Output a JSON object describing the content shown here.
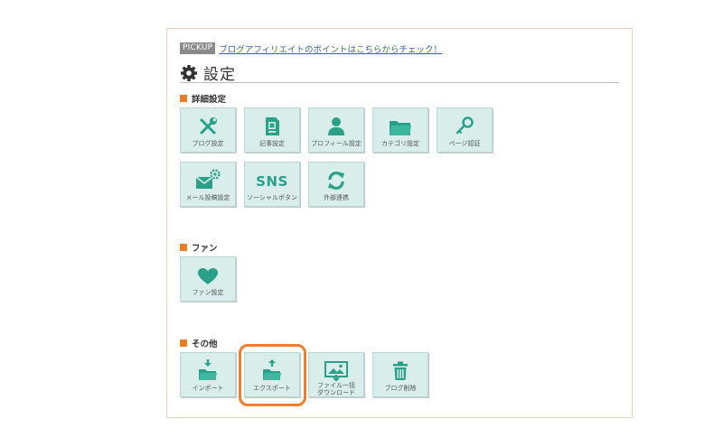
{
  "pickup": {
    "badge": "PICKUP",
    "link": "ブログアフィリエイトのポイントはこちらからチェック！"
  },
  "page": {
    "title": "設定",
    "title_icon": "gear-icon"
  },
  "colors": {
    "accent": "#ea7d22",
    "tile_bg": "#d9eeeb",
    "icon": "#2aa089",
    "highlight": "#ee7d2d"
  },
  "sections": {
    "detail": {
      "heading": "詳細設定",
      "tiles": [
        {
          "label": "ブログ設定",
          "icon": "tools-icon"
        },
        {
          "label": "記事設定",
          "icon": "document-icon"
        },
        {
          "label": "プロフィール設定",
          "icon": "user-icon"
        },
        {
          "label": "カテゴリ設定",
          "icon": "folder-icon"
        },
        {
          "label": "ページ認証",
          "icon": "key-icon"
        },
        {
          "label": "メール投稿設定",
          "icon": "mail-gear-icon"
        },
        {
          "label": "ソーシャルボタン",
          "icon_text": "SNS"
        },
        {
          "label": "外部連携",
          "icon": "sync-icon"
        }
      ]
    },
    "fan": {
      "heading": "ファン",
      "tiles": [
        {
          "label": "ファン設定",
          "icon": "heart-icon"
        }
      ]
    },
    "other": {
      "heading": "その他",
      "tiles": [
        {
          "label": "インポート",
          "icon": "folder-import-icon"
        },
        {
          "label": "エクスポート",
          "icon": "folder-export-icon"
        },
        {
          "label_line1": "ファイル一括",
          "label_line2": "ダウンロード",
          "icon": "download-image-icon"
        },
        {
          "label": "ブログ削除",
          "icon": "trash-icon"
        }
      ]
    }
  }
}
